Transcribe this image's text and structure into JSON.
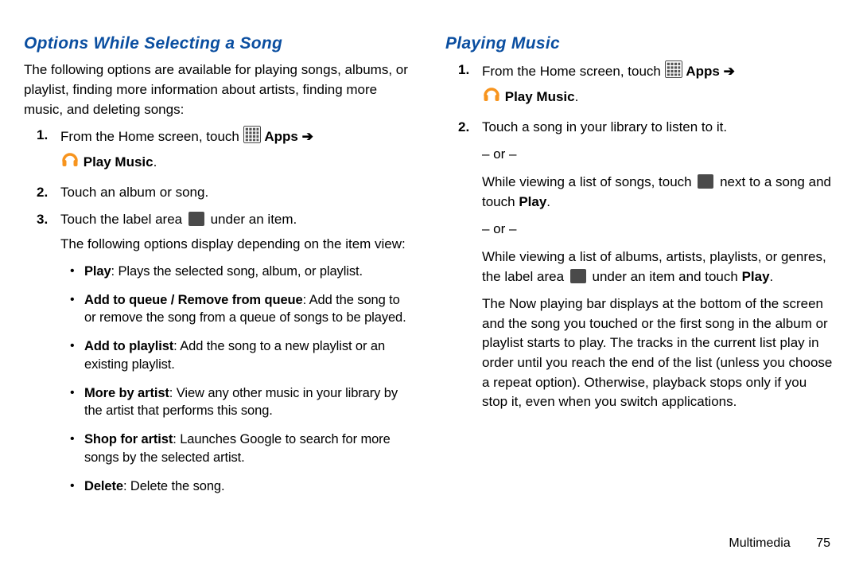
{
  "left": {
    "heading": "Options While Selecting a Song",
    "intro": "The following options are available for playing songs, albums, or playlist, finding more information about artists, finding more music, and deleting songs:",
    "step1a": "From the Home screen, touch ",
    "apps_label": "Apps",
    "arrow": "➔",
    "play_music_label": "Play Music",
    "dot": ".",
    "step2": "Touch an album or song.",
    "step3a": "Touch the label area ",
    "step3b": " under an item.",
    "step3_follow": "The following options display depending on the item view:",
    "bullets": {
      "play_b": "Play",
      "play_rest": ": Plays the selected song, album, or playlist.",
      "addq_b": "Add to queue / Remove from queue",
      "addq_rest": ": Add the song to or remove the song from a queue of songs to be played.",
      "addp_b": "Add to playlist",
      "addp_rest": ": Add the song to a new playlist or an existing playlist.",
      "more_b": "More by artist",
      "more_rest": ": View any other music in your library by the artist that performs this song.",
      "shop_b": "Shop for artist",
      "shop_rest": ": Launches Google to search for more songs by the selected artist.",
      "del_b": "Delete",
      "del_rest": ": Delete the song."
    }
  },
  "right": {
    "heading": "Playing Music",
    "step1a": "From the Home screen, touch ",
    "apps_label": "Apps",
    "arrow": "➔",
    "play_music_label": "Play Music",
    "dot": ".",
    "step2": "Touch a song in your library to listen to it.",
    "or": "– or –",
    "para2a": "While viewing a list of songs, touch ",
    "para2b": " next to a song and touch ",
    "play_b": "Play",
    "para3a": "While viewing a list of albums, artists, playlists, or genres, the label area ",
    "para3b": " under an item and touch ",
    "nowplaying": "The Now playing bar displays at the bottom of the screen and the song you touched or the first song in the album or playlist starts to play. The tracks in the current list play in order until you reach the end of the list (unless you choose a repeat option). Otherwise, playback stops only if you stop it, even when you switch applications."
  },
  "footer": {
    "section": "Multimedia",
    "page": "75"
  }
}
